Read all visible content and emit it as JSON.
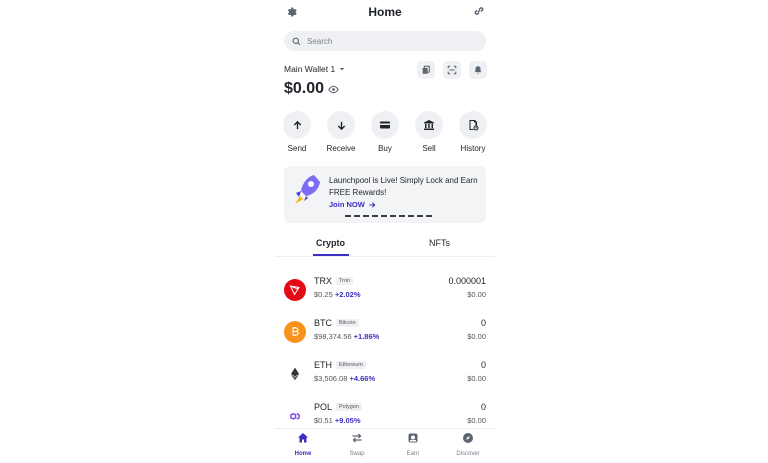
{
  "header": {
    "title": "Home"
  },
  "search": {
    "placeholder": "Search"
  },
  "wallet": {
    "name": "Main Wallet 1",
    "balance": "$0.00"
  },
  "actions": [
    {
      "label": "Send",
      "icon": "arrow-up-icon"
    },
    {
      "label": "Receive",
      "icon": "arrow-down-icon"
    },
    {
      "label": "Buy",
      "icon": "card-icon"
    },
    {
      "label": "Sell",
      "icon": "bank-icon"
    },
    {
      "label": "History",
      "icon": "history-icon"
    }
  ],
  "banner": {
    "text": "Launchpool is Live! Simply Lock and Earn FREE Rewards!",
    "cta": "Join NOW"
  },
  "tabs": [
    {
      "label": "Crypto",
      "active": true
    },
    {
      "label": "NFTs",
      "active": false
    }
  ],
  "assets": [
    {
      "symbol": "TRX",
      "name": "Tron",
      "price": "$0.25",
      "change": "+2.02%",
      "amount": "0.000001",
      "value": "$0.00",
      "color": "#e50915"
    },
    {
      "symbol": "BTC",
      "name": "Bitcoin",
      "price": "$98,374.56",
      "change": "+1.86%",
      "amount": "0",
      "value": "$0.00",
      "color": "#f7931a"
    },
    {
      "symbol": "ETH",
      "name": "Ethereum",
      "price": "$3,506.08",
      "change": "+4.66%",
      "amount": "0",
      "value": "$0.00",
      "color": "#ffffff"
    },
    {
      "symbol": "POL",
      "name": "Polygon",
      "price": "$0.51",
      "change": "+9.05%",
      "amount": "0",
      "value": "$0.00",
      "color": "#ffffff"
    }
  ],
  "nav": [
    {
      "label": "Home",
      "active": true
    },
    {
      "label": "Swap",
      "active": false
    },
    {
      "label": "Earn",
      "active": false
    },
    {
      "label": "Discover",
      "active": false
    }
  ],
  "colors": {
    "accent": "#3a2ec2",
    "surface": "#eef0f3",
    "text": "#1e2329"
  }
}
